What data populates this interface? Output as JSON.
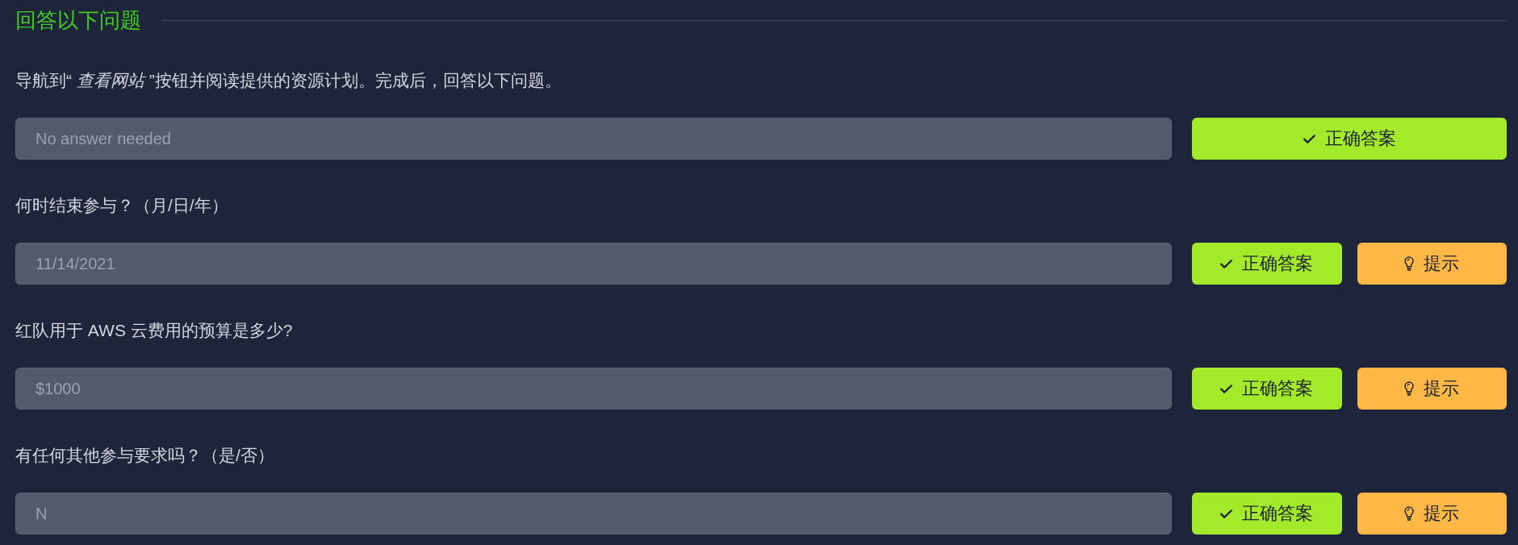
{
  "section": {
    "title": "回答以下问题"
  },
  "questions": [
    {
      "text": "导航到“ *查看网站* ”按钮并阅读提供的资源计划。完成后，回答以下问题。",
      "answer": {
        "placeholder": "No answer needed",
        "disabled": true
      },
      "buttons": [
        {
          "kind": "correct",
          "label": "正确答案"
        }
      ]
    },
    {
      "text": "何时结束参与？（月/日/年）",
      "answer": {
        "value": "11/14/2021",
        "disabled": true
      },
      "buttons": [
        {
          "kind": "correct",
          "label": "正确答案"
        },
        {
          "kind": "hint",
          "label": "提示"
        }
      ]
    },
    {
      "text": "红队用于 AWS 云费用的预算是多少?",
      "answer": {
        "value": "$1000",
        "disabled": true
      },
      "buttons": [
        {
          "kind": "correct",
          "label": "正确答案"
        },
        {
          "kind": "hint",
          "label": "提示"
        }
      ]
    },
    {
      "text": "有任何其他参与要求吗？（是/否）",
      "answer": {
        "value": "N",
        "disabled": true
      },
      "buttons": [
        {
          "kind": "correct",
          "label": "正确答案"
        },
        {
          "kind": "hint",
          "label": "提示"
        }
      ]
    }
  ]
}
